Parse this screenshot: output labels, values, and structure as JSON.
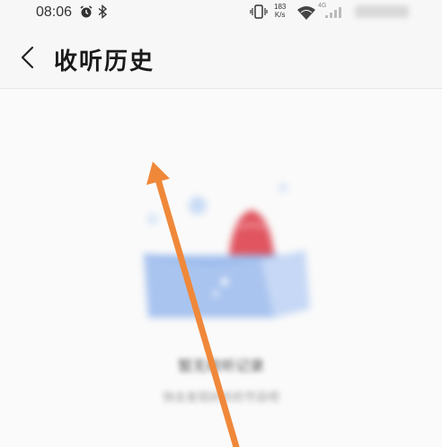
{
  "status_bar": {
    "time": "08:06",
    "network_speed_value": "183",
    "network_speed_unit": "K/s",
    "network_type": "4G",
    "icons": [
      "alarm-icon",
      "bluetooth-icon",
      "vibrate-icon",
      "wifi-icon",
      "signal-icon",
      "battery-icon"
    ]
  },
  "header": {
    "back_icon": "chevron-left-icon",
    "title": "收听历史"
  },
  "empty_state": {
    "illustration": "empty-box-illustration",
    "title": "暂无收听记录",
    "subtitle": "快去发现好听的节目吧"
  },
  "annotation": {
    "color": "#f0883a",
    "icon": "arrow-up-annotation"
  }
}
